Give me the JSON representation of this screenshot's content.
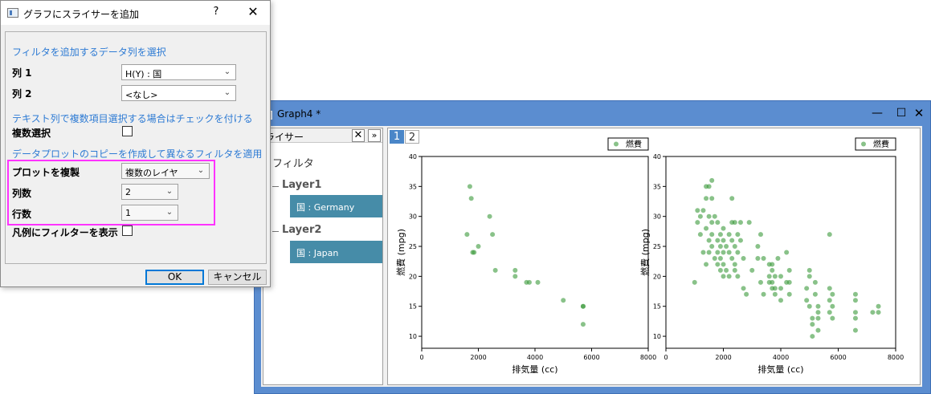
{
  "dialog": {
    "title": "グラフにスライサーを追加",
    "help_label": "?",
    "close_label": "✕",
    "section_add_filter": "フィルタを追加するデータ列を選択",
    "column1_label": "列 1",
    "column1_value": "H(Y) : 国",
    "column2_label": "列 2",
    "column2_value": "<なし>",
    "section_text_column": "テキスト列で複数項目選択する場合はチェックを付ける",
    "multi_select_label": "複数選択",
    "multi_select_checked": false,
    "section_copy_plot": "データプロットのコピーを作成して異なるフィルタを適用",
    "duplicate_plot_label": "プロットを複製",
    "duplicate_plot_value": "複数のレイヤ",
    "num_columns_label": "列数",
    "num_columns_value": "2",
    "num_rows_label": "行数",
    "num_rows_value": "1",
    "show_filter_legend_label": "凡例にフィルターを表示",
    "show_filter_legend_checked": false,
    "ok_label": "OK",
    "cancel_label": "キャンセル"
  },
  "graph_window": {
    "title": "Graph4 *",
    "minimize_label": "—",
    "maximize_label": "☐",
    "close_label": "✕"
  },
  "slicer": {
    "header_title": "ライサー",
    "close_label": "✕",
    "pin_label": "»",
    "root_label": "フィルタ",
    "layers": [
      {
        "label": "Layer1",
        "filter": "国 : Germany"
      },
      {
        "label": "Layer2",
        "filter": "国 : Japan"
      }
    ]
  },
  "layer_tabs": [
    "1",
    "2"
  ],
  "colors": {
    "accent": "#2e7bd4",
    "highlight": "#ff33ff",
    "filter_chip": "#468ca8",
    "marker": "#3a9a3a"
  },
  "chart_data": [
    {
      "type": "scatter",
      "title": "",
      "xlabel": "排気量 (cc)",
      "ylabel": "燃費 (mpg)",
      "xlim": [
        0,
        8000
      ],
      "ylim": [
        8,
        40
      ],
      "xticks": [
        0,
        2000,
        4000,
        6000,
        8000
      ],
      "yticks": [
        10,
        15,
        20,
        25,
        30,
        35,
        40
      ],
      "legend": "top-right",
      "series": [
        {
          "name": "燃費",
          "points": [
            [
              1600,
              27
            ],
            [
              1700,
              35
            ],
            [
              1750,
              33
            ],
            [
              1800,
              24
            ],
            [
              1850,
              24
            ],
            [
              2000,
              25
            ],
            [
              2400,
              30
            ],
            [
              2500,
              27
            ],
            [
              2600,
              21
            ],
            [
              3300,
              21
            ],
            [
              3300,
              20
            ],
            [
              3700,
              19
            ],
            [
              3800,
              19
            ],
            [
              4100,
              19
            ],
            [
              5000,
              16
            ],
            [
              5700,
              15
            ],
            [
              5700,
              15
            ],
            [
              5700,
              12
            ]
          ]
        }
      ]
    },
    {
      "type": "scatter",
      "title": "",
      "xlabel": "排気量 (cc)",
      "ylabel": "燃費 (mpg)",
      "xlim": [
        0,
        8000
      ],
      "ylim": [
        8,
        40
      ],
      "xticks": [
        0,
        2000,
        4000,
        6000,
        8000
      ],
      "yticks": [
        10,
        15,
        20,
        25,
        30,
        35,
        40
      ],
      "legend": "top-right",
      "series": [
        {
          "name": "燃費",
          "points": [
            [
              1000,
              19
            ],
            [
              1100,
              29
            ],
            [
              1100,
              31
            ],
            [
              1200,
              30
            ],
            [
              1200,
              27
            ],
            [
              1300,
              24
            ],
            [
              1300,
              31
            ],
            [
              1400,
              35
            ],
            [
              1400,
              33
            ],
            [
              1400,
              28
            ],
            [
              1400,
              22
            ],
            [
              1500,
              35
            ],
            [
              1500,
              30
            ],
            [
              1500,
              26
            ],
            [
              1500,
              24
            ],
            [
              1600,
              36
            ],
            [
              1600,
              33
            ],
            [
              1600,
              29
            ],
            [
              1600,
              27
            ],
            [
              1600,
              25
            ],
            [
              1700,
              30
            ],
            [
              1700,
              23
            ],
            [
              1800,
              29
            ],
            [
              1800,
              26
            ],
            [
              1800,
              24
            ],
            [
              1800,
              22
            ],
            [
              1900,
              27
            ],
            [
              1900,
              25
            ],
            [
              1900,
              23
            ],
            [
              1900,
              21
            ],
            [
              2000,
              28
            ],
            [
              2000,
              26
            ],
            [
              2000,
              24
            ],
            [
              2000,
              22
            ],
            [
              2000,
              20
            ],
            [
              2100,
              25
            ],
            [
              2100,
              21
            ],
            [
              2200,
              27
            ],
            [
              2200,
              24
            ],
            [
              2200,
              20
            ],
            [
              2300,
              29
            ],
            [
              2300,
              33
            ],
            [
              2300,
              26
            ],
            [
              2300,
              23
            ],
            [
              2400,
              29
            ],
            [
              2400,
              25
            ],
            [
              2400,
              22
            ],
            [
              2400,
              21
            ],
            [
              2500,
              27
            ],
            [
              2500,
              24
            ],
            [
              2500,
              20
            ],
            [
              2600,
              29
            ],
            [
              2600,
              26
            ],
            [
              2700,
              23
            ],
            [
              2700,
              18
            ],
            [
              2800,
              17
            ],
            [
              2900,
              29
            ],
            [
              3000,
              21
            ],
            [
              3200,
              25
            ],
            [
              3200,
              23
            ],
            [
              3300,
              27
            ],
            [
              3300,
              19
            ],
            [
              3400,
              23
            ],
            [
              3400,
              17
            ],
            [
              3600,
              22
            ],
            [
              3600,
              20
            ],
            [
              3600,
              19
            ],
            [
              3700,
              22
            ],
            [
              3700,
              21
            ],
            [
              3700,
              19
            ],
            [
              3700,
              18
            ],
            [
              3800,
              20
            ],
            [
              3800,
              18
            ],
            [
              3800,
              17
            ],
            [
              3900,
              23
            ],
            [
              4000,
              20
            ],
            [
              4000,
              18
            ],
            [
              4000,
              16
            ],
            [
              4200,
              24
            ],
            [
              4200,
              19
            ],
            [
              4300,
              21
            ],
            [
              4300,
              19
            ],
            [
              4300,
              17
            ],
            [
              4900,
              18
            ],
            [
              4900,
              16
            ],
            [
              5000,
              21
            ],
            [
              5000,
              20
            ],
            [
              5000,
              15
            ],
            [
              5100,
              13
            ],
            [
              5100,
              12
            ],
            [
              5100,
              10
            ],
            [
              5200,
              19
            ],
            [
              5200,
              17
            ],
            [
              5300,
              15
            ],
            [
              5300,
              14
            ],
            [
              5300,
              13
            ],
            [
              5300,
              11
            ],
            [
              5700,
              27
            ],
            [
              5700,
              18
            ],
            [
              5700,
              16
            ],
            [
              5700,
              14
            ],
            [
              5800,
              17
            ],
            [
              5800,
              15
            ],
            [
              5800,
              13
            ],
            [
              6600,
              17
            ],
            [
              6600,
              16
            ],
            [
              6600,
              14
            ],
            [
              6600,
              13
            ],
            [
              6600,
              11
            ],
            [
              7200,
              14
            ],
            [
              7400,
              15
            ],
            [
              7400,
              14
            ]
          ]
        }
      ]
    }
  ]
}
